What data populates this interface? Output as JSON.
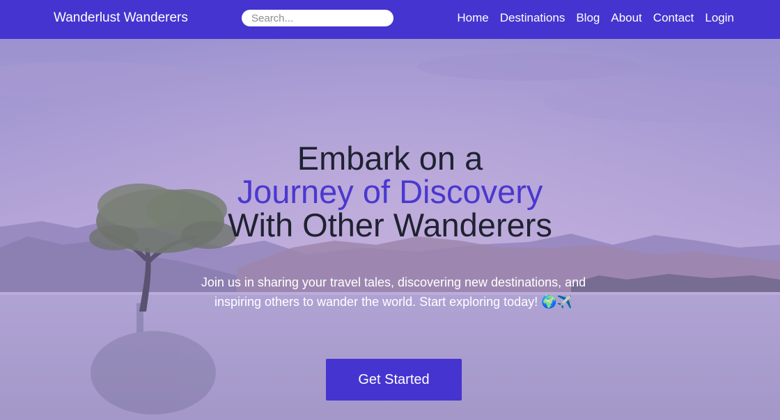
{
  "nav": {
    "brand": "Wanderlust Wanderers",
    "search_placeholder": "Search...",
    "links": [
      "Home",
      "Destinations",
      "Blog",
      "About",
      "Contact",
      "Login"
    ]
  },
  "hero": {
    "line1": "Embark on a",
    "line2": "Journey of Discovery",
    "line3": "With Other Wanderers",
    "intro": "Join us in sharing your travel tales, discovering new destinations, and inspiring others to wander the world. Start exploring today! 🌍✈️",
    "cta_label": "Get Started"
  },
  "colors": {
    "nav_bg": "#4534cf",
    "accent_text": "#4a38cf",
    "heading_text": "#1f2230",
    "overlay": "#a99cd6"
  }
}
